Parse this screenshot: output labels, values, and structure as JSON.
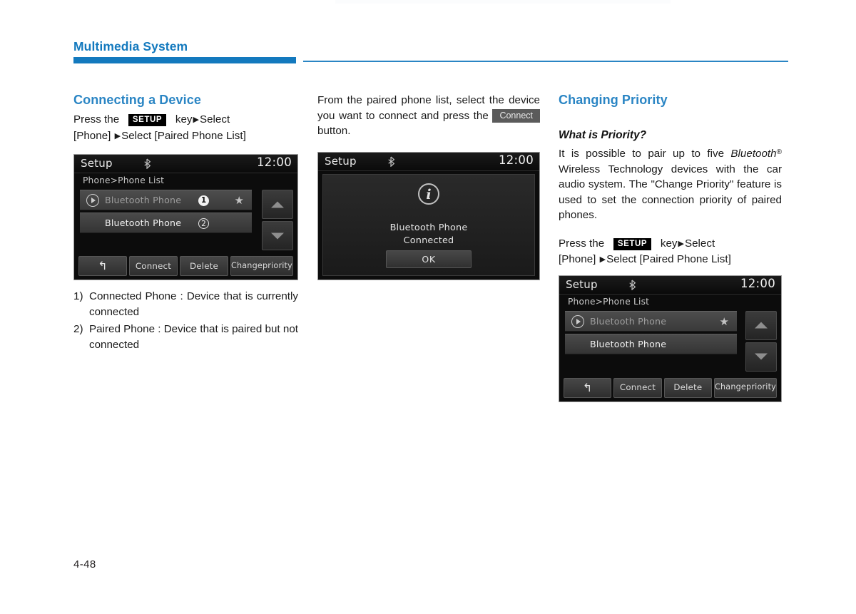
{
  "page": {
    "header_title": "Multimedia System",
    "page_number": "4-48"
  },
  "column_left": {
    "section_title": "Connecting a Device",
    "instruction": {
      "before_key": "Press    the",
      "key_label": "SETUP",
      "after_key": "key",
      "arrow": "▶",
      "line1_tail": "Select",
      "line2": "[Phone]",
      "line2_tail": "Select [Paired Phone List]"
    },
    "screenshot": {
      "title": "Setup",
      "bt_icon": "bluetooth-icon",
      "clock": "12:00",
      "breadcrumb": "Phone>Phone List",
      "rows": [
        {
          "label": "Bluetooth Phone",
          "marker": "①",
          "starred": true,
          "state": "connected"
        },
        {
          "label": "Bluetooth Phone",
          "marker": "②",
          "starred": false,
          "state": "paired"
        }
      ],
      "scroll_up": "▲",
      "scroll_down": "▼",
      "buttons": [
        {
          "name": "back",
          "label": "↰"
        },
        {
          "name": "connect",
          "label": "Connect"
        },
        {
          "name": "delete",
          "label": "Delete"
        },
        {
          "name": "change-priority",
          "label": "Change\npriority"
        }
      ]
    },
    "notes": [
      {
        "marker": "1)",
        "text": "Connected Phone : Device that is currently connected"
      },
      {
        "marker": "2)",
        "text": "Paired Phone : Device that is paired but not connected"
      }
    ]
  },
  "column_middle": {
    "paragraph_before": "From the paired phone list, select the device you want to connect and press the",
    "inline_button": "Connect",
    "paragraph_after": "button.",
    "screenshot": {
      "title": "Setup",
      "bt_icon": "bluetooth-icon",
      "clock": "12:00",
      "info_icon": "i",
      "message_line1": "Bluetooth Phone",
      "message_line2": "Connected",
      "ok_label": "OK"
    }
  },
  "column_right": {
    "section_title": "Changing Priority",
    "sub_title": "What is Priority?",
    "paragraph_part1": "It is possible to pair up to five",
    "paragraph_bluetooth": "Bluetooth",
    "paragraph_reg": "®",
    "paragraph_part2": "Wireless Technology devices with the car audio system. The \"Change Priority\" feature is used to set the connection priority of paired phones.",
    "instruction": {
      "before_key": "Press    the",
      "key_label": "SETUP",
      "after_key": "key",
      "arrow": "▶",
      "line1_tail": "Select",
      "line2": "[Phone]",
      "line2_tail": "Select [Paired Phone List]"
    },
    "screenshot": {
      "title": "Setup",
      "bt_icon": "bluetooth-icon",
      "clock": "12:00",
      "breadcrumb": "Phone>Phone List",
      "rows": [
        {
          "label": "Bluetooth Phone",
          "starred": true,
          "state": "connected"
        },
        {
          "label": "Bluetooth Phone",
          "starred": false,
          "state": "paired"
        }
      ],
      "scroll_up": "▲",
      "scroll_down": "▼",
      "buttons": [
        {
          "name": "back",
          "label": "↰"
        },
        {
          "name": "connect",
          "label": "Connect"
        },
        {
          "name": "delete",
          "label": "Delete"
        },
        {
          "name": "change-priority-line1",
          "label": "Change"
        },
        {
          "name": "change-priority-line2",
          "label": "priority"
        }
      ]
    }
  },
  "colors": {
    "accent_blue": "#1379be",
    "title_blue": "#2a85c4",
    "screen_bg": "#0c0c0c"
  }
}
